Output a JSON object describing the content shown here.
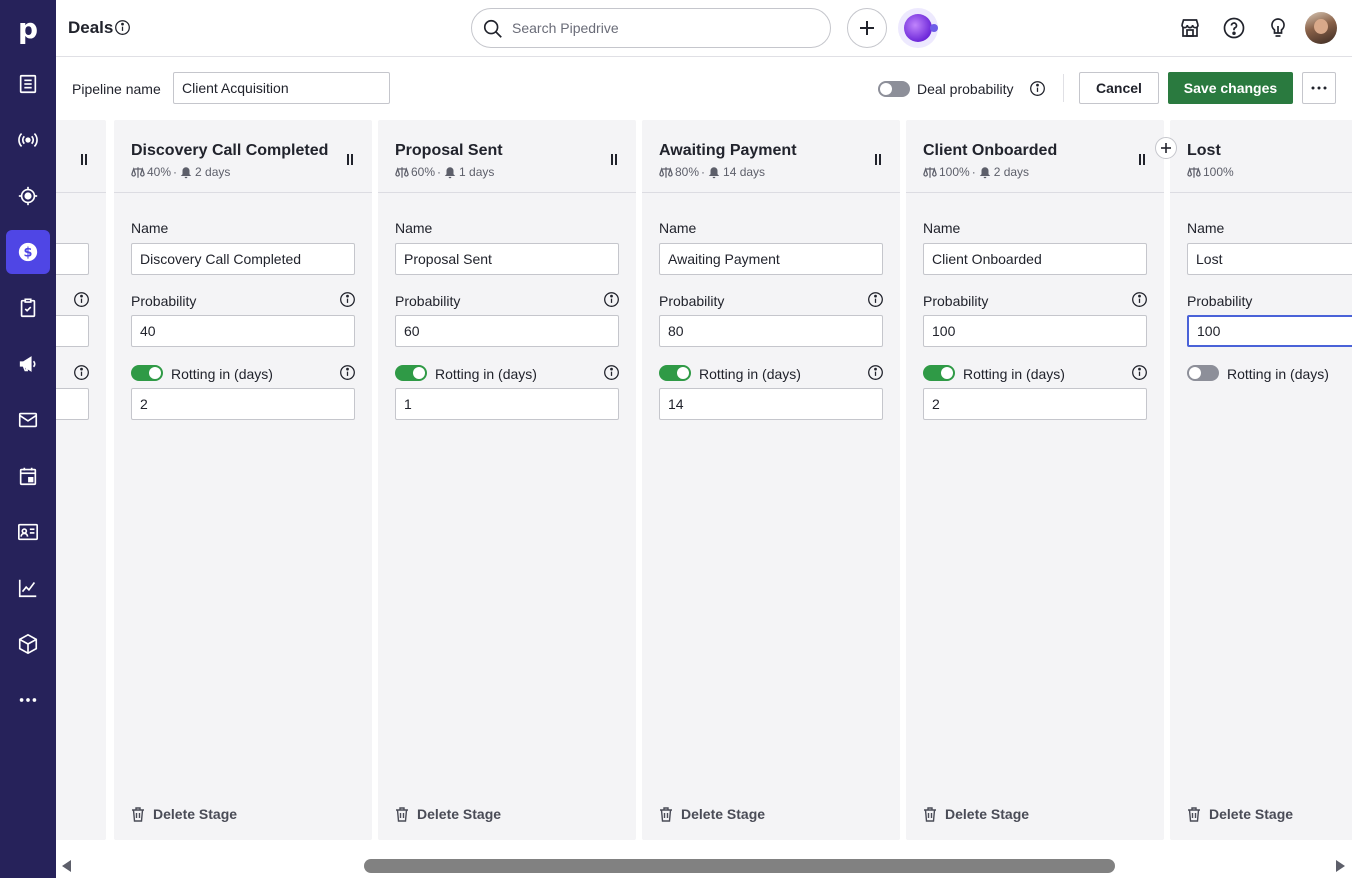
{
  "app": {
    "title": "Deals",
    "search_placeholder": "Search Pipedrive",
    "brand_color": "#26225a",
    "accent_color": "#4f46e5",
    "success_color": "#2a7a3f"
  },
  "sidebar": {
    "logo": "p",
    "items": [
      {
        "icon": "leads-inbox-icon"
      },
      {
        "icon": "campaigns-signal-icon"
      },
      {
        "icon": "target-icon"
      },
      {
        "icon": "deals-dollar-icon",
        "active": true
      },
      {
        "icon": "activities-clipboard-icon"
      },
      {
        "icon": "megaphone-icon"
      },
      {
        "icon": "mail-icon"
      },
      {
        "icon": "calendar-icon"
      },
      {
        "icon": "contacts-card-icon"
      },
      {
        "icon": "insights-chart-icon"
      },
      {
        "icon": "products-box-icon"
      },
      {
        "icon": "more-dots-icon"
      }
    ]
  },
  "toolbar": {
    "pipeline_label": "Pipeline name",
    "pipeline_value": "Client Acquisition",
    "deal_probability_label": "Deal probability",
    "deal_probability_enabled": false,
    "cancel_label": "Cancel",
    "save_label": "Save changes"
  },
  "field_labels": {
    "name": "Name",
    "probability": "Probability",
    "rotting": "Rotting in (days)",
    "delete": "Delete Stage"
  },
  "stages": [
    {
      "name": "Discovery Call Completed",
      "probability_meta": "40%",
      "rotting_meta": "2 days",
      "name_value": "Discovery Call Completed",
      "probability": "40",
      "rotting_enabled": true,
      "rotting_days": "2"
    },
    {
      "name": "Proposal Sent",
      "probability_meta": "60%",
      "rotting_meta": "1 days",
      "name_value": "Proposal Sent",
      "probability": "60",
      "rotting_enabled": true,
      "rotting_days": "1"
    },
    {
      "name": "Awaiting Payment",
      "probability_meta": "80%",
      "rotting_meta": "14 days",
      "name_value": "Awaiting Payment",
      "probability": "80",
      "rotting_enabled": true,
      "rotting_days": "14"
    },
    {
      "name": "Client Onboarded",
      "probability_meta": "100%",
      "rotting_meta": "2 days",
      "name_value": "Client Onboarded",
      "probability": "100",
      "rotting_enabled": true,
      "rotting_days": "2"
    },
    {
      "name": "Lost",
      "probability_meta": "100%",
      "rotting_meta": "",
      "name_value": "Lost",
      "probability": "100",
      "rotting_enabled": false,
      "rotting_days": ""
    }
  ]
}
